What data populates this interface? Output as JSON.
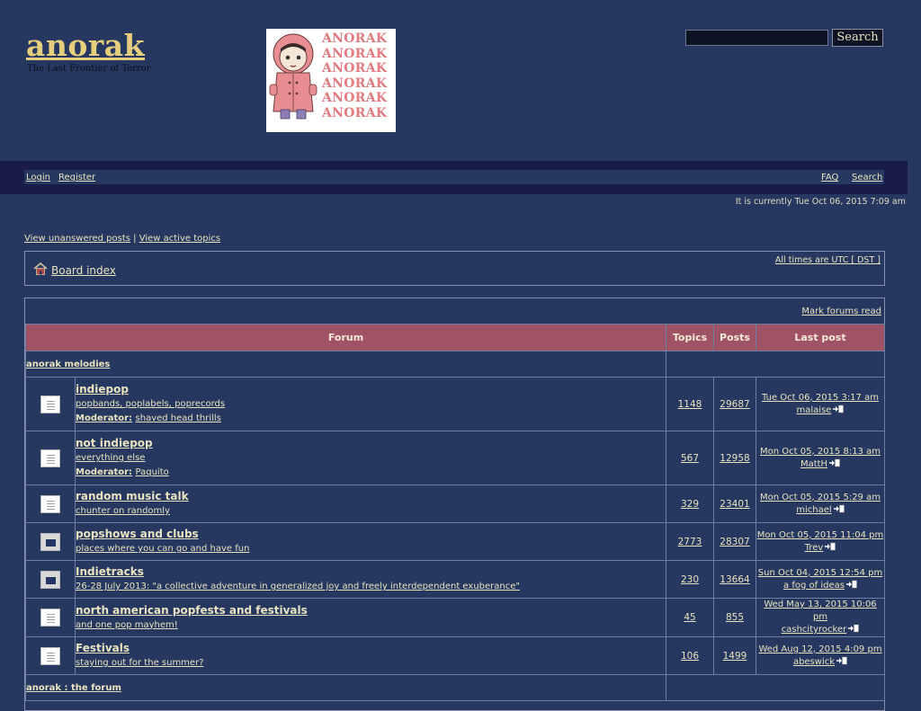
{
  "site": {
    "title": "anorak",
    "tagline": "The Last Frontier of Terror",
    "logo_words": [
      "ANORAK",
      "ANORAK",
      "ANORAK",
      "ANORAK",
      "ANORAK",
      "ANORAK"
    ]
  },
  "search": {
    "button_label": "Search",
    "value": ""
  },
  "nav": {
    "login": "Login",
    "register": "Register",
    "faq": "FAQ",
    "search": "Search"
  },
  "current_time": "It is currently Tue Oct 06, 2015 7:09 am",
  "links": {
    "unanswered": "View unanswered posts",
    "separator": "|",
    "active": "View active topics"
  },
  "breadcrumb": {
    "board_index": "Board index",
    "timezone": "All times are UTC [ DST ]"
  },
  "forum_list": {
    "mark_read": "Mark forums read",
    "headers": {
      "forum": "Forum",
      "topics": "Topics",
      "posts": "Posts",
      "last_post": "Last post"
    },
    "categories": [
      {
        "name": "anorak melodies"
      },
      {
        "name": "anorak : the forum"
      }
    ],
    "forums": [
      {
        "name": "indiepop",
        "desc": "popbands, poplabels, poprecords",
        "moderator_label": "Moderator:",
        "moderator": "shaved head thrills",
        "topics": "1148",
        "posts": "29687",
        "last_date": "Tue Oct 06, 2015 3:17 am",
        "last_user": "malaise",
        "status": "read"
      },
      {
        "name": "not indiepop",
        "desc": "everything else",
        "moderator_label": "Moderator:",
        "moderator": "Paquito",
        "topics": "567",
        "posts": "12958",
        "last_date": "Mon Oct 05, 2015 8:13 am",
        "last_user": "MattH",
        "status": "read"
      },
      {
        "name": "random music talk",
        "desc": "chunter on randomly",
        "topics": "329",
        "posts": "23401",
        "last_date": "Mon Oct 05, 2015 5:29 am",
        "last_user": "michael",
        "status": "read"
      },
      {
        "name": "popshows and clubs",
        "desc": "places where you can go and have fun",
        "topics": "2773",
        "posts": "28307",
        "last_date": "Mon Oct 05, 2015 11:04 pm",
        "last_user": "Trev",
        "status": "unread"
      },
      {
        "name": "Indietracks",
        "desc": "26-28 July 2013: \"a collective adventure in generalized joy and freely interdependent exuberance\"",
        "topics": "230",
        "posts": "13664",
        "last_date": "Sun Oct 04, 2015 12:54 pm",
        "last_user": "a fog of ideas",
        "status": "unread"
      },
      {
        "name": "north american popfests and festivals",
        "desc": "and one pop mayhem!",
        "topics": "45",
        "posts": "855",
        "last_date": "Wed May 13, 2015 10:06 pm",
        "last_user": "cashcityrocker",
        "status": "read"
      },
      {
        "name": "Festivals",
        "desc": "staying out for the summer?",
        "topics": "106",
        "posts": "1499",
        "last_date": "Wed Aug 12, 2015 4:09 pm",
        "last_user": "abeswick",
        "status": "read"
      }
    ]
  }
}
